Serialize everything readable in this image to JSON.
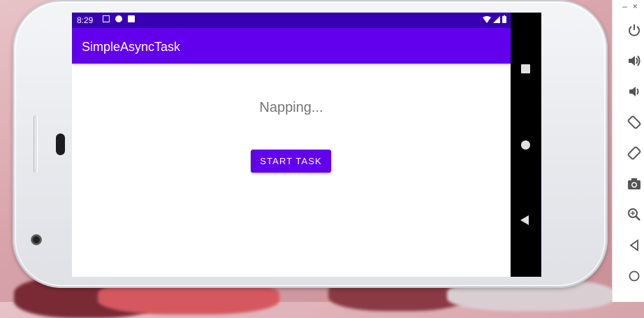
{
  "status_bar": {
    "time": "8:29"
  },
  "app_bar": {
    "title": "SimpleAsyncTask"
  },
  "main": {
    "status_text": "Napping...",
    "start_button_label": "START TASK"
  },
  "colors": {
    "status_bar": "#3700b3",
    "app_bar": "#6200ee",
    "button": "#6200ee",
    "status_text": "#757575"
  },
  "emulator_toolbar": {
    "window_controls": [
      "–",
      "×"
    ],
    "buttons": [
      "power-icon",
      "volume-up-icon",
      "volume-down-icon",
      "rotate-left-icon",
      "rotate-right-icon",
      "camera-icon",
      "zoom-icon",
      "back-icon",
      "home-icon"
    ]
  }
}
